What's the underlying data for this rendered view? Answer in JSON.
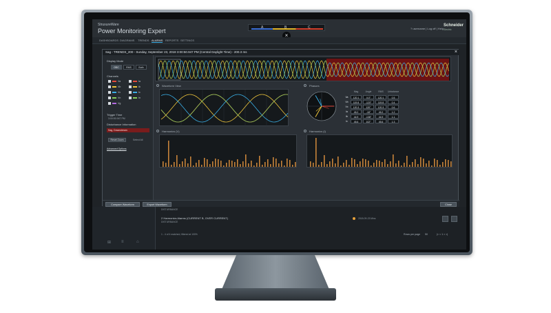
{
  "app": {
    "brand_line": "StruxureWare",
    "title": "Power Monitoring Expert",
    "header_links": "? username | Log off | Help",
    "logo_name": "Schneider",
    "logo_sub": "Electric",
    "phase_legend": [
      "A",
      "B",
      "C"
    ]
  },
  "nav": {
    "items": [
      "DASHBOARDS",
      "DIAGRAMS",
      "TRENDS",
      "ALARMS",
      "REPORTS",
      "SETTINGS"
    ],
    "active_index": 3
  },
  "dialog": {
    "title": "Sag - TRENDS_200 - Sunday, September 23, 2018 3:00:50.947 PM (Central Daylight Time) - 200.3 ms",
    "close_label": "×",
    "left": {
      "display_mode_label": "Display Mode",
      "display_modes": [
        "OSC",
        "RMS",
        "Both"
      ],
      "display_mode_selected": 0,
      "channels_label": "Channels",
      "channels": [
        {
          "name": "Va",
          "color": "#e84a3c"
        },
        {
          "name": "Ia",
          "color": "#e84a3c"
        },
        {
          "name": "Vb",
          "color": "#f0c63c"
        },
        {
          "name": "Ib",
          "color": "#f0c63c"
        },
        {
          "name": "Vc",
          "color": "#3ab0e8"
        },
        {
          "name": "Ic",
          "color": "#3ab0e8"
        },
        {
          "name": "Vn",
          "color": "#8ad05a"
        },
        {
          "name": "In",
          "color": "#8ad05a"
        },
        {
          "name": "Vg",
          "color": "#b46be0"
        }
      ],
      "trigger_time_label": "Trigger Time",
      "trigger_time_value": "3:00:50.947 PM",
      "disturbance_label": "Disturbance Information",
      "disturbance_value": "Sag, Downstream",
      "reset_label": "Reset Zoom",
      "select_all_label": "Select All",
      "advanced_label": "Advanced Options"
    },
    "panels": {
      "timeline_label": "",
      "waveform_label": "Waveform View",
      "phasor_label": "Phasors",
      "harmonics_v_label": "Harmonics (V)",
      "harmonics_i_label": "Harmonics (I)"
    },
    "phasor_table": {
      "headers": [
        "",
        "Mag",
        "Angle",
        "RMS",
        "Unbalance"
      ],
      "rows": [
        {
          "ch": "Va",
          "mag": "120.1",
          "angle": "0.0°",
          "rms": "120.1",
          "unb": "0.5"
        },
        {
          "ch": "Vb",
          "mag": "119.8",
          "angle": "-120°",
          "rms": "119.8",
          "unb": "0.4"
        },
        {
          "ch": "Vc",
          "mag": "120.3",
          "angle": "120°",
          "rms": "120.3",
          "unb": "0.6"
        },
        {
          "ch": "Ia",
          "mag": "45.2",
          "angle": "-18°",
          "rms": "45.2",
          "unb": "1.2"
        },
        {
          "ch": "Ib",
          "mag": "44.9",
          "angle": "-138°",
          "rms": "44.9",
          "unb": "1.1"
        },
        {
          "ch": "Ic",
          "mag": "45.6",
          "angle": "102°",
          "rms": "45.6",
          "unb": "1.3"
        }
      ]
    },
    "buttons": {
      "compare": "Compare Waveform",
      "export": "Export Waveform",
      "close": "Close"
    }
  },
  "list": {
    "row1_sub": "DISTURBANCE",
    "row2_title": "2 Harmonics Alarms (CURRENT B, OVER CURRENT)",
    "row2_sub": "DISTURBANCE",
    "row2_right": "2018-09-23 Mins",
    "footer_count": "1 - 4 of 4 matched, filtered at 100%",
    "page_label": "Rows per page",
    "page_size": "50",
    "page_nav": "|< < 1 > >|"
  },
  "colors": {
    "phase_a": "#e84a3c",
    "phase_b": "#f0c63c",
    "phase_c": "#3ab0e8",
    "phase_n": "#8ad05a",
    "highlight": "#8a1010",
    "harmonic_bar": "#c8843a"
  }
}
